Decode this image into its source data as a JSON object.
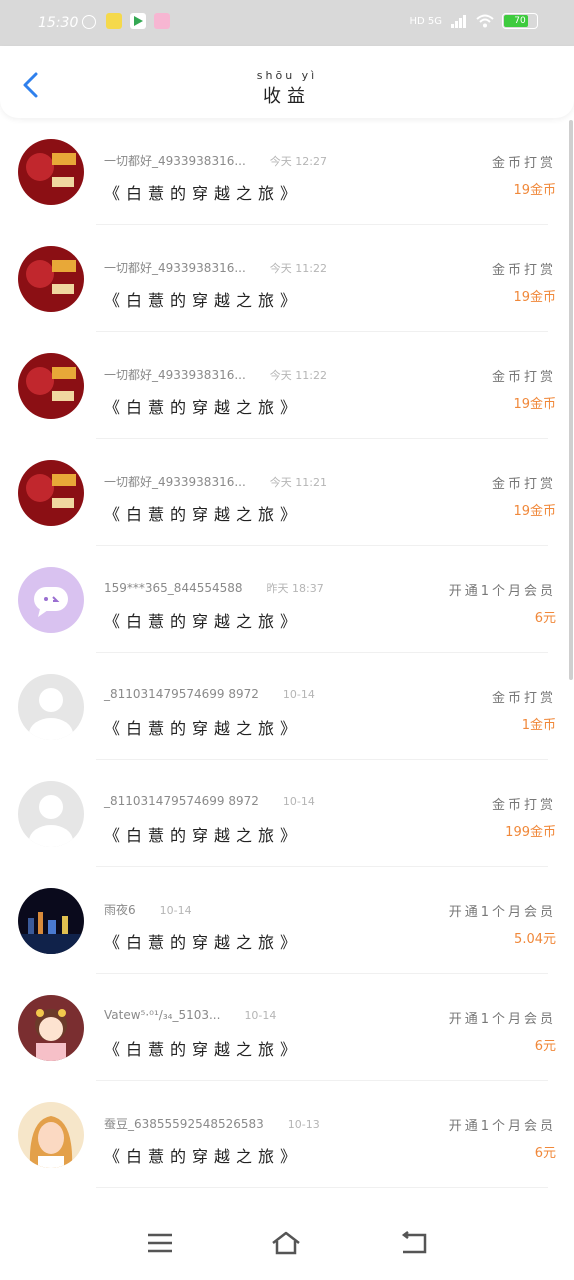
{
  "status": {
    "time": "15:30",
    "network": "HD  5G",
    "battery": "70",
    "battery_level": 0.7
  },
  "header": {
    "title_pinyin": "shōu yì",
    "title": "收益"
  },
  "list": [
    {
      "name": "一切都好_4933938316...",
      "time": "今天 12:27",
      "book": "《白薏的穿越之旅》",
      "type": "金币打赏",
      "amount": "19金币",
      "avatar": "red"
    },
    {
      "name": "一切都好_4933938316...",
      "time": "今天 11:22",
      "book": "《白薏的穿越之旅》",
      "type": "金币打赏",
      "amount": "19金币",
      "avatar": "red"
    },
    {
      "name": "一切都好_4933938316...",
      "time": "今天 11:22",
      "book": "《白薏的穿越之旅》",
      "type": "金币打赏",
      "amount": "19金币",
      "avatar": "red"
    },
    {
      "name": "一切都好_4933938316...",
      "time": "今天 11:21",
      "book": "《白薏的穿越之旅》",
      "type": "金币打赏",
      "amount": "19金币",
      "avatar": "red"
    },
    {
      "name": "159***365_844554588",
      "time": "昨天 18:37",
      "book": "《白薏的穿越之旅》",
      "type": "开通1个月会员",
      "amount": "6元",
      "avatar": "purple"
    },
    {
      "name": "_811031479574699 8972",
      "time": "10-14",
      "book": "《白薏的穿越之旅》",
      "type": "金币打赏",
      "amount": "1金币",
      "avatar": "gray"
    },
    {
      "name": "_811031479574699 8972",
      "time": "10-14",
      "book": "《白薏的穿越之旅》",
      "type": "金币打赏",
      "amount": "199金币",
      "avatar": "gray"
    },
    {
      "name": "雨夜6",
      "time": "10-14",
      "book": "《白薏的穿越之旅》",
      "type": "开通1个月会员",
      "amount": "5.04元",
      "avatar": "night"
    },
    {
      "name": "Vatew⁵·⁰¹/₃₄_5103...",
      "time": "10-14",
      "book": "《白薏的穿越之旅》",
      "type": "开通1个月会员",
      "amount": "6元",
      "avatar": "girl"
    },
    {
      "name": "蚕豆_63855592548526583",
      "time": "10-13",
      "book": "《白薏的穿越之旅》",
      "type": "开通1个月会员",
      "amount": "6元",
      "avatar": "blonde"
    }
  ],
  "colors": {
    "accent": "#2f80ed",
    "amount": "#f0883a",
    "status_bar": "#d9d9d9"
  },
  "nav": {
    "icons": [
      "menu-icon",
      "home-icon",
      "back-icon"
    ]
  }
}
